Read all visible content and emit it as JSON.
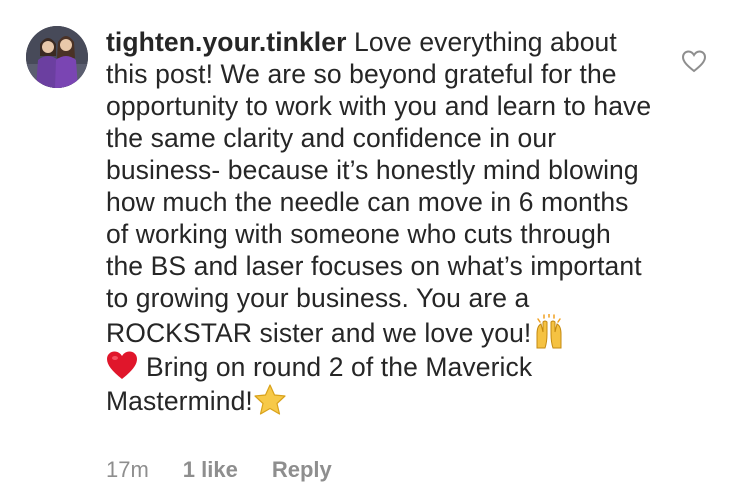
{
  "comment": {
    "username": "tighten.your.tinkler",
    "text_part_1": " Love everything about this post! We are so beyond grateful for the opportunity to work with you and learn to have the same clarity and confidence in our business- because it’s honestly mind blowing how much the needle can move in 6 months of working with someone who cuts through the BS and laser focuses on what’s important to growing your business. You are a ROCKSTAR sister and we love you!",
    "text_part_2": "Bring on round 2 of the Maverick Mastermind!",
    "emoji_after_part_1": "raising-hands-icon",
    "emoji_before_part_2": "red-heart-icon",
    "emoji_after_part_2": "star-icon"
  },
  "meta": {
    "time": "17m",
    "likes": "1 like",
    "reply": "Reply"
  },
  "colors": {
    "text": "#262626",
    "secondary": "#8e8e8e",
    "heart_outline": "#8e8e8e",
    "red_heart": "#e0162b",
    "star": "#f7c948",
    "hands": "#f5c242"
  },
  "icons": {
    "like_button": "heart-outline-icon",
    "avatar": "avatar"
  }
}
